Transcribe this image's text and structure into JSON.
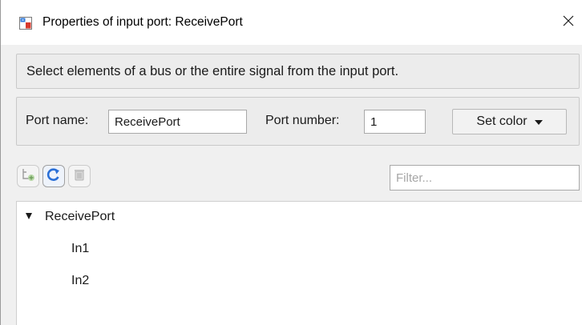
{
  "window": {
    "title": "Properties of input port: ReceivePort",
    "icon": "simulink-block-icon",
    "close_icon": "close-icon"
  },
  "instruction": {
    "text": "Select elements of a bus or the entire signal from the input port."
  },
  "port": {
    "name_label": "Port name:",
    "name_value": "ReceivePort",
    "number_label": "Port number:",
    "number_value": "1",
    "set_color_label": "Set color"
  },
  "toolbar": {
    "add_icon": "add-element-icon",
    "refresh_icon": "refresh-icon",
    "delete_icon": "delete-icon",
    "filter_placeholder": "Filter..."
  },
  "tree": {
    "root": {
      "label": "ReceivePort",
      "expanded": true,
      "children": [
        {
          "label": "In1"
        },
        {
          "label": "In2"
        }
      ]
    }
  },
  "colors": {
    "panel_bg": "#ececec",
    "window_bg": "#f0f0f0",
    "icon_accent": "#2a6fd6"
  }
}
